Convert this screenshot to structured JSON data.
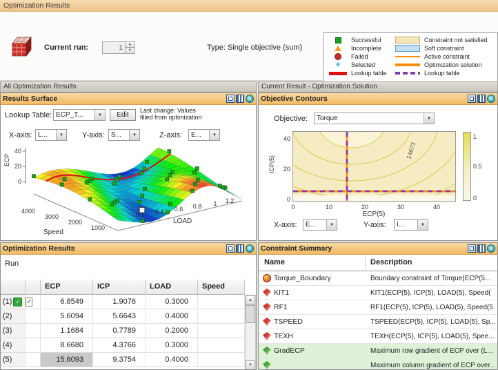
{
  "window": {
    "title": "Optimization Results"
  },
  "toolbar": {
    "current_run_label": "Current run:",
    "current_run_value": "1",
    "type_text": "Type: Single objective (sum)"
  },
  "legend": {
    "left": [
      "Successful",
      "Incomplete",
      "Failed",
      "Selected",
      "Lookup table"
    ],
    "right": [
      "Constraint not satisfied",
      "Soft constraint",
      "Active constraint",
      "Optimization solution",
      "Lookup table"
    ]
  },
  "left": {
    "header": "All Optimization Results",
    "surface": {
      "title": "Results Surface",
      "lookup_label": "Lookup Table:",
      "lookup_value": "ECP_T...",
      "edit_button": "Edit",
      "last_change_line1": "Last change: Values",
      "last_change_line2": "filled from optimization",
      "x_axis_label": "X-axis:",
      "x_axis_value": "L...",
      "y_axis_label": "Y-axis:",
      "y_axis_value": "S...",
      "z_axis_label": "Z-axis:",
      "z_axis_value": "E...",
      "plot": {
        "z_label": "ECP",
        "z_ticks": [
          "40",
          "20",
          "0"
        ],
        "speed_label": "Speed",
        "speed_ticks": [
          "4000",
          "3000",
          "2000",
          "1000"
        ],
        "load_label": "LOAD",
        "load_ticks": [
          "0.2",
          "0.4",
          "0.6",
          "0.8",
          "1",
          "1.2"
        ]
      }
    },
    "results": {
      "title": "Optimization Results",
      "run_label": "Run",
      "columns": [
        "ECP",
        "ICP",
        "LOAD",
        "Speed"
      ],
      "rows": [
        {
          "id": "(1)",
          "ecp": "6.8549",
          "icp": "1.9076",
          "load": "0.3000",
          "speed": ""
        },
        {
          "id": "(2)",
          "ecp": "5.6094",
          "icp": "5.6643",
          "load": "0.4000",
          "speed": ""
        },
        {
          "id": "(3)",
          "ecp": "1.1684",
          "icp": "0.7789",
          "load": "0.2000",
          "speed": ""
        },
        {
          "id": "(4)",
          "ecp": "8.6680",
          "icp": "4.3766",
          "load": "0.3000",
          "speed": ""
        },
        {
          "id": "(5)",
          "ecp": "15.6093",
          "icp": "9.3754",
          "load": "0.4000",
          "speed": ""
        }
      ]
    }
  },
  "right": {
    "header": "Current Result - Optimization Solution",
    "contours": {
      "title": "Objective Contours",
      "objective_label": "Objective:",
      "objective_value": "Torque",
      "x_axis_label": "X-axis:",
      "x_axis_value": "E...",
      "y_axis_label": "Y-axis:",
      "y_axis_value": "I...",
      "plot": {
        "y_label": "ICP(5)",
        "y_ticks": [
          "40",
          "20",
          "0"
        ],
        "x_label": "ECP(5)",
        "x_ticks": [
          "0",
          "10",
          "20",
          "30",
          "40"
        ],
        "colorbar_ticks": [
          "1",
          "0.5",
          "0"
        ],
        "contour_label": "14673"
      }
    },
    "constraints": {
      "title": "Constraint Summary",
      "columns": [
        "Name",
        "Description"
      ],
      "rows": [
        {
          "name": "Torque_Boundary",
          "desc": "Boundary constraint of Torque(ECP(5..."
        },
        {
          "name": "KIT1",
          "desc": "KIT1(ECP(5), ICP(5), LOAD(5), Speed("
        },
        {
          "name": "RF1",
          "desc": "RF1(ECP(5), ICP(5), LOAD(5), Speed(5"
        },
        {
          "name": "TSPEED",
          "desc": "TSPEED(ECP(5), ICP(5), LOAD(5), Sp..."
        },
        {
          "name": "TEXH",
          "desc": "TEXH(ECP(5), ICP(5), LOAD(5), Spee..."
        },
        {
          "name": "GradECP",
          "desc": "Maximum row gradient of ECP over (L..."
        },
        {
          "name": "",
          "desc": "Maximum column gradient of ECP over..."
        }
      ]
    }
  },
  "colors": {
    "panel_header_orange": "#f0ba62",
    "solution_orange": "#ff8c1a",
    "lookup_purple": "#8040a8",
    "lookup_red": "#e01010",
    "successful_green": "#17a317",
    "constraint_not_satisfied_bg": "#f6ecc3",
    "soft_constraint_blue": "#c2e0f0",
    "highlight_green": "#dff2d8"
  }
}
